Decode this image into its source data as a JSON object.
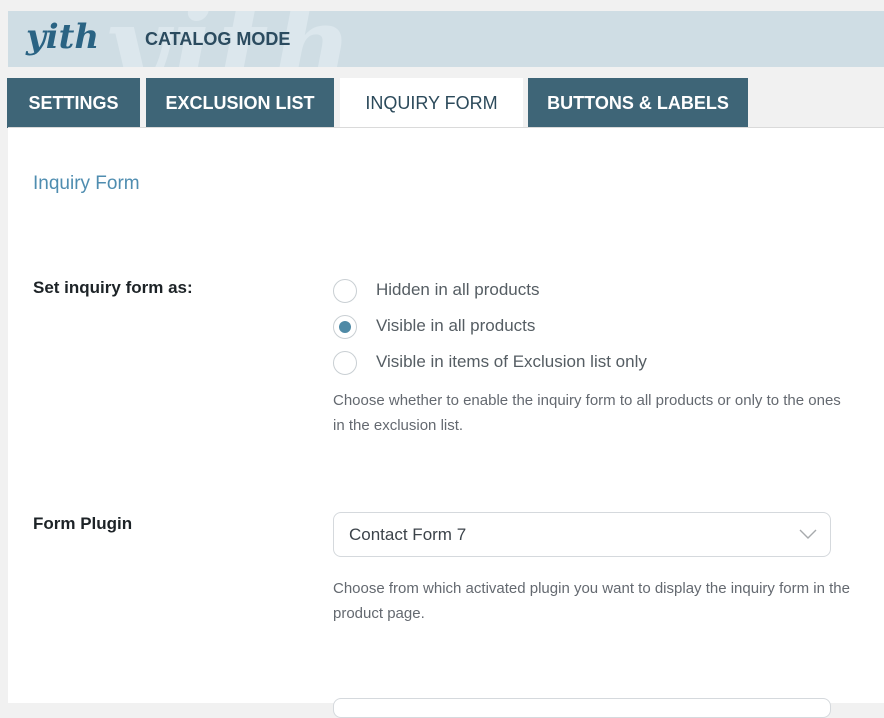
{
  "header": {
    "logo_text": "yith",
    "title": "CATALOG MODE"
  },
  "tabs": [
    {
      "label": "SETTINGS",
      "active": false
    },
    {
      "label": "EXCLUSION LIST",
      "active": false
    },
    {
      "label": "INQUIRY FORM",
      "active": true
    },
    {
      "label": "BUTTONS & LABELS",
      "active": false
    }
  ],
  "section": {
    "title": "Inquiry Form"
  },
  "inquiry_setting": {
    "label": "Set inquiry form as:",
    "options": [
      {
        "label": "Hidden in all products",
        "checked": false
      },
      {
        "label": "Visible in all products",
        "checked": true
      },
      {
        "label": "Visible in items of Exclusion list only",
        "checked": false
      }
    ],
    "description": "Choose whether to enable the inquiry form to all products or only to the ones in the exclusion list."
  },
  "form_plugin": {
    "label": "Form Plugin",
    "selected": "Contact Form 7",
    "description": "Choose from which activated plugin you want to display the inquiry form in the product page."
  },
  "colors": {
    "tab_bg": "#3e6577",
    "accent": "#4f8aa6",
    "title": "#4f8db0"
  },
  "icons": {
    "select_arrow": "chevron-down-icon"
  }
}
